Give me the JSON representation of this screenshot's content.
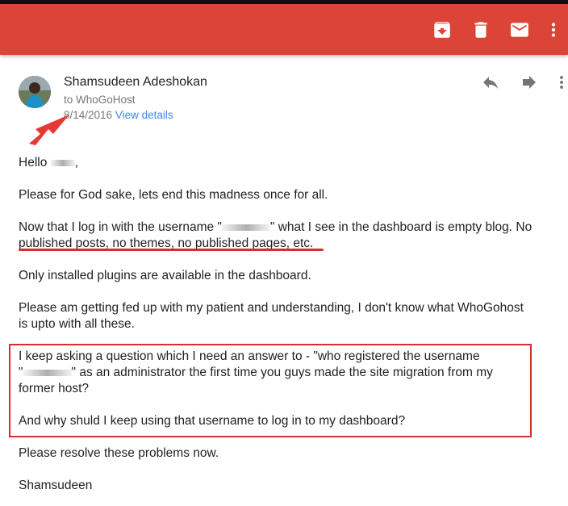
{
  "toolbar": {
    "accent": "#db4437",
    "actions": [
      "archive-icon",
      "delete-icon",
      "mail-icon",
      "more-vert-icon"
    ]
  },
  "message": {
    "sender": "Shamsudeen Adeshokan",
    "to": "to WhoGoHost",
    "date": "8/14/2016",
    "view_details": "View details",
    "actions": [
      "reply-icon",
      "forward-icon",
      "more-vert-icon"
    ]
  },
  "body": {
    "greeting": "Hello",
    "greeting_end": ",",
    "p1": "Please for God sake, lets end this madness once for all.",
    "p2_line1_a": "Now that I log in with the username \"",
    "p2_line1_b": "\" what I see in the dashboard is empty blog. No",
    "p2_line2": "published posts, no themes, no published pages, etc.",
    "p3": "Only installed plugins are available in the dashboard.",
    "p4_line1": "Please am getting fed up with my patient and understanding, I don't know what WhoGohost",
    "p4_line2": "is upto with all these.",
    "p5_line1": "I keep asking a question which I need an answer to -  \"who registered the username",
    "p5_line2_a": "\"",
    "p5_line2_b": "\" as an administrator the first time you guys made the site migration from my",
    "p5_line3": "former host?",
    "p6": "And why shuld I keep using that username to log in to my dashboard?",
    "p7": "Please resolve these problems now.",
    "signature": "Shamsudeen"
  }
}
